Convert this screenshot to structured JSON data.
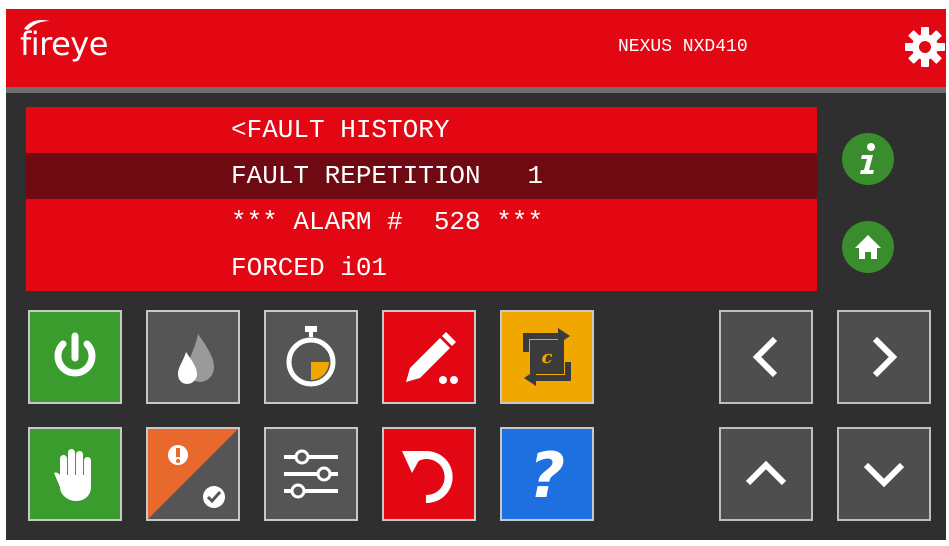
{
  "header": {
    "brand": "fireye",
    "model": "NEXUS NXD410",
    "settings_icon": "gear-icon"
  },
  "display": {
    "lines": [
      "<FAULT HISTORY",
      "FAULT REPETITION   1",
      "*** ALARM #  528 ***",
      "FORCED i01"
    ],
    "selected_line": 2
  },
  "side_buttons": [
    {
      "icon": "info-icon"
    },
    {
      "icon": "home-icon"
    }
  ],
  "function_buttons": {
    "row1": [
      "power-icon",
      "flame-icon",
      "timer-icon",
      "edit-icon",
      "cycle-c-icon"
    ],
    "row2": [
      "hand-stop-icon",
      "alarm-ack-icon",
      "sliders-icon",
      "undo-icon",
      "help-icon"
    ]
  },
  "nav_buttons": [
    "left-arrow-icon",
    "right-arrow-icon",
    "up-arrow-icon",
    "down-arrow-icon"
  ],
  "colors": {
    "brand_red": "#e30613",
    "selected_row": "#6f0a12",
    "green": "#3a9c2d",
    "yellow": "#f0a800",
    "blue": "#1e6fe0",
    "panel": "#2f2f2f"
  }
}
